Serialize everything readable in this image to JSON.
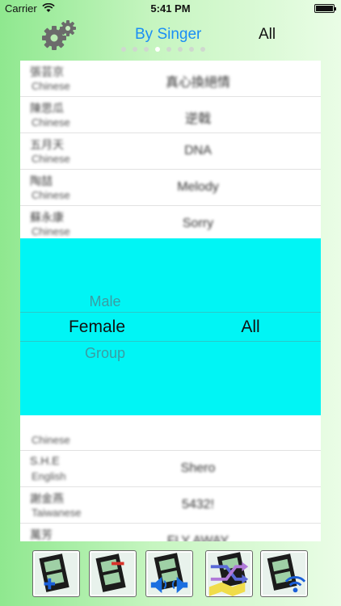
{
  "status": {
    "carrier": "Carrier",
    "time": "5:41 PM"
  },
  "nav": {
    "tabs": [
      {
        "label": "By Singer"
      },
      {
        "label": "All"
      }
    ],
    "page_count": 8,
    "active_page": 4
  },
  "list_top": [
    {
      "singer": "張芸京",
      "language": "Chinese",
      "song": "真心換絕情"
    },
    {
      "singer": "陳思瓜",
      "language": "Chinese",
      "song": "逆戟"
    },
    {
      "singer": "五月天",
      "language": "Chinese",
      "song": "DNA"
    },
    {
      "singer": "陶喆",
      "language": "Chinese",
      "song": "Melody"
    },
    {
      "singer": "蘇永康",
      "language": "Chinese",
      "song": "Sorry"
    }
  ],
  "picker": {
    "left": {
      "above": "Male",
      "selected": "Female",
      "below": "Group"
    },
    "right": {
      "selected": "All"
    }
  },
  "list_bottom": [
    {
      "singer": "",
      "language": "Chinese",
      "song": ""
    },
    {
      "singer": "S.H.E",
      "language": "English",
      "song": "Shero"
    },
    {
      "singer": "謝金燕",
      "language": "Taiwanese",
      "song": "5432!"
    },
    {
      "singer": "萬芳",
      "language": "Chinese",
      "song": "FLY AWAY"
    },
    {
      "singer": "",
      "language": "Chinese",
      "song": ""
    }
  ],
  "toolbar": [
    {
      "icon": "film-add-icon"
    },
    {
      "icon": "film-remove-icon"
    },
    {
      "icon": "film-audio-icon"
    },
    {
      "icon": "film-shuffle-icon"
    },
    {
      "icon": "film-wifi-icon"
    }
  ]
}
